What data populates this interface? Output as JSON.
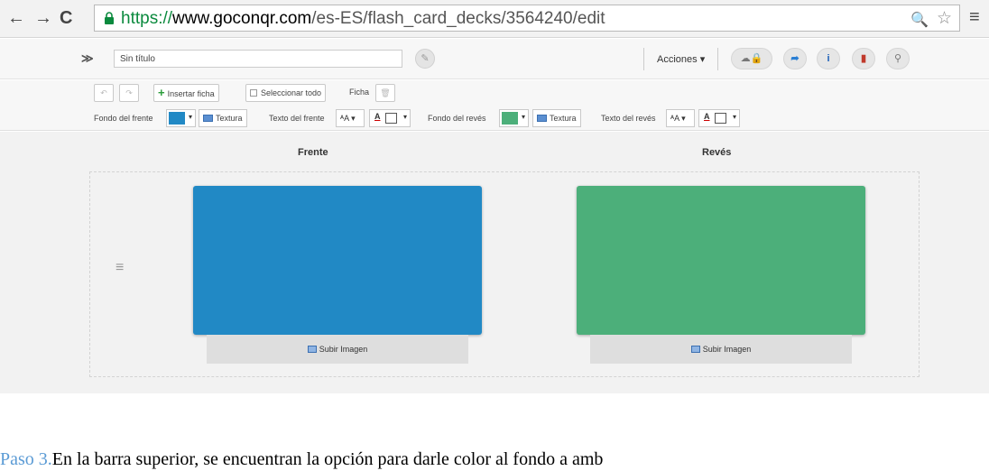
{
  "browser": {
    "back_icon": "←",
    "forward_icon": "→",
    "reload_icon": "C",
    "url_scheme": "https://",
    "url_host": "www.goconqr.com",
    "url_path": "/es-ES/flash_card_decks/3564240/edit",
    "zoom_icon": "🔍",
    "star_icon": "☆",
    "menu_icon": "≡"
  },
  "header": {
    "collapse_icon": "≫",
    "title_value": "Sin título",
    "actions_label": "Acciones ▾"
  },
  "toolbar": {
    "insert_card": "Insertar ficha",
    "select_all": "Seleccionar todo",
    "card_label": "Ficha",
    "front_bg_label": "Fondo del frente",
    "texture_label": "Textura",
    "front_text_label": "Texto del frente",
    "back_bg_label": "Fondo del revés",
    "back_text_label": "Texto del revés",
    "size_label": "ᴬA ▾",
    "color_letter": "A",
    "caret": "▾"
  },
  "colors": {
    "front": "#2189c5",
    "back": "#4caf7a"
  },
  "editor": {
    "front_heading": "Frente",
    "back_heading": "Revés",
    "drag_handle": "≡",
    "upload_label": "Subir Imagen"
  },
  "caption": {
    "step": "Paso 3.",
    "text": "En la barra superior, se encuentran la opción para darle color al fondo a amb"
  }
}
